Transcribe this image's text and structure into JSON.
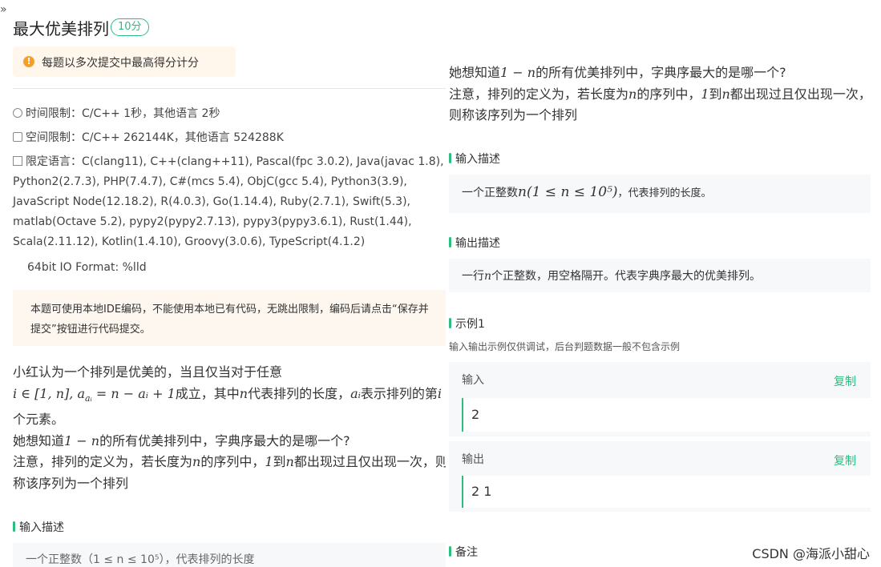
{
  "collapse_glyph": "»",
  "problem": {
    "title": "最大优美排列",
    "score": "10分",
    "notice": "每题以多次提交中最高得分计分",
    "time_limit": "时间限制：C/C++ 1秒，其他语言 2秒",
    "space_limit": "空间限制：C/C++ 262144K，其他语言 524288K",
    "languages": "限定语言：C(clang11), C++(clang++11), Pascal(fpc 3.0.2), Java(javac 1.8), Python2(2.7.3), PHP(7.4.7), C#(mcs 5.4), ObjC(gcc 5.4), Python3(3.9), JavaScript Node(12.18.2), R(4.0.3), Go(1.14.4), Ruby(2.7.1), Swift(5.3), matlab(Octave 5.2), pypy2(pypy2.7.13), pypy3(pypy3.6.1), Rust(1.44), Scala(2.11.12), Kotlin(1.4.10), Groovy(3.0.6), TypeScript(4.1.2)",
    "io_format": "64bit IO Format: %lld",
    "ide_notice": "本题可使用本地IDE编码，不能使用本地已有代码，无跳出限制，编码后请点击“保存并提交”按钮进行代码提交。"
  },
  "description": {
    "line1": "小红认为一个排列是优美的，当且仅当对于任意",
    "math1": "i ∈ [1, n], a",
    "math1_sub": "aᵢ",
    "math1_rest": " = n − aᵢ + 1",
    "text1": "成立，其中",
    "n": "n",
    "text2": "代表排列的长度，",
    "ai": "aᵢ",
    "text3": "表示排列的第",
    "i": "i",
    "text4": "个元素。",
    "ask_pre": "她想知道",
    "ask_math": "1 − n",
    "ask_post": "的所有优美排列中，字典序最大的是哪一个?",
    "note_pre": "注意，排列的定义为，若长度为",
    "note_mid": "的序列中，",
    "note_one": "1",
    "note_to": "到",
    "note_post": "都出现过且仅出现一次，则称该序列为一个排列"
  },
  "input_desc": {
    "heading": "输入描述",
    "pre": "一个正整数",
    "math": "n(1 ≤ n ≤ 10⁵)",
    "post": "，代表排列的长度。",
    "cut_off": "一个正整数（1 ≤ n ≤ 10⁵），代表排列的长度"
  },
  "output_desc": {
    "heading": "输出描述",
    "pre": "一行",
    "post": "个正整数，用空格隔开。代表字典序最大的优美排列。"
  },
  "example": {
    "heading": "示例1",
    "hint": "输入输出示例仅供调试，后台判题数据一般不包含示例",
    "input_label": "输入",
    "output_label": "输出",
    "copy_label": "复制",
    "input_value": "2",
    "output_value": "2 1"
  },
  "remarks_heading": "备注",
  "watermark": "CSDN @海派小甜心",
  "colors": {
    "accent": "#2dbd80",
    "warning": "#f3a02a",
    "notice_bg": "#fff7ec",
    "box_bg": "#f7f8fa"
  },
  "icons": [
    "clock-icon",
    "cube-icon",
    "code-icon",
    "warning-icon"
  ]
}
